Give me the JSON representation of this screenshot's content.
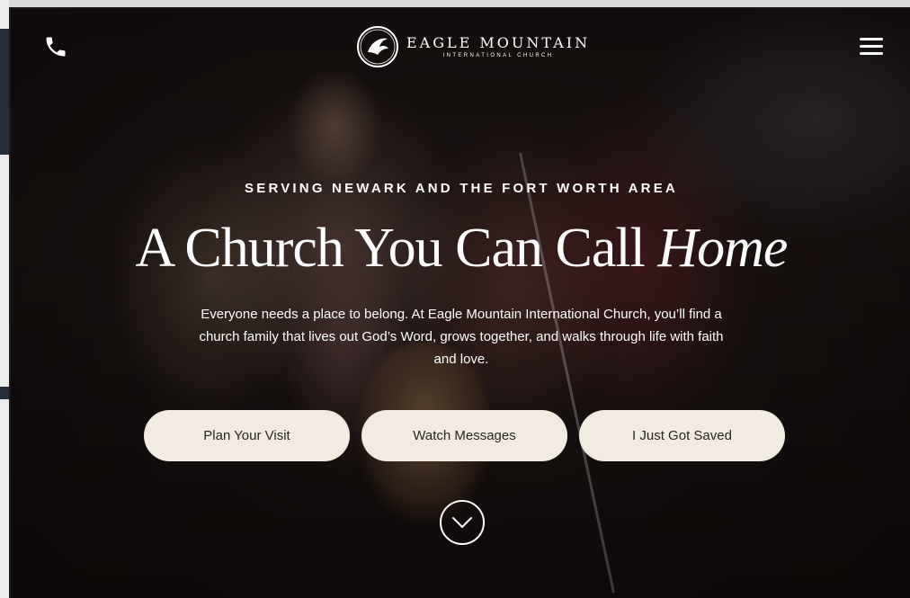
{
  "header": {
    "logo_name": "EAGLE MOUNTAIN",
    "logo_subtitle": "INTERNATIONAL CHURCH",
    "phone_icon": "phone-icon",
    "menu_icon": "hamburger-menu-icon"
  },
  "hero": {
    "eyebrow": "SERVING NEWARK AND THE FORT WORTH AREA",
    "headline_main": "A Church You Can Call ",
    "headline_emphasis": "Home",
    "intro": "Everyone needs a place to belong. At Eagle Mountain International Church, you’ll find a church family that lives out God’s Word, grows together, and walks through life with faith and love.",
    "buttons": [
      {
        "label": "Plan Your Visit"
      },
      {
        "label": "Watch Messages"
      },
      {
        "label": "I Just Got Saved"
      }
    ],
    "scroll_icon": "chevron-down-icon"
  },
  "colors": {
    "button_bg": "#f1ebe1",
    "button_text": "#2a2420",
    "text": "#ffffff",
    "background": "#1c1413"
  }
}
